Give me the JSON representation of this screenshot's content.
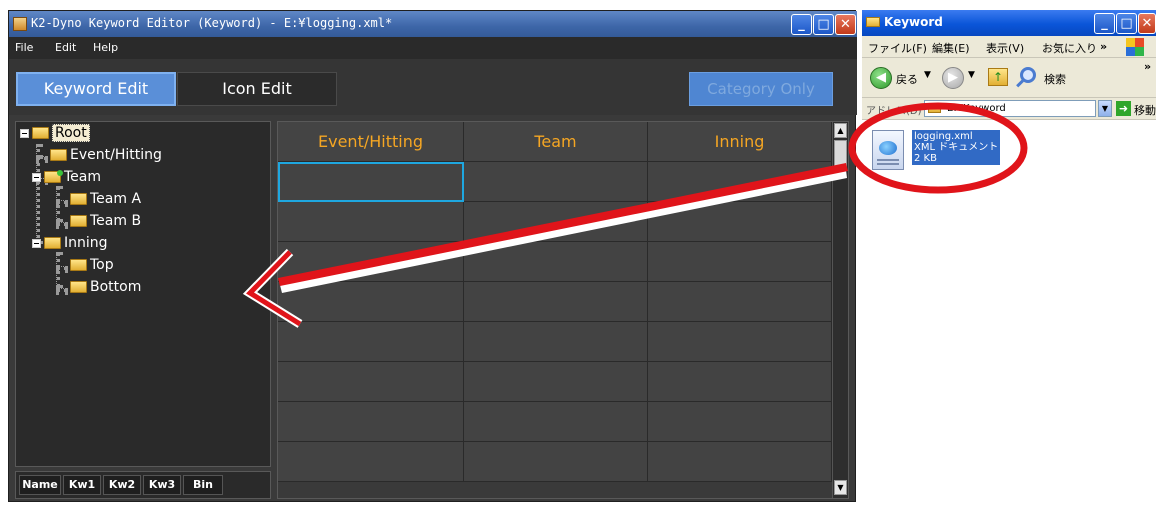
{
  "app": {
    "title": "K2-Dyno Keyword Editor (Keyword) - E:¥logging.xml*",
    "menu": [
      "File",
      "Edit",
      "Help"
    ],
    "tabs": {
      "keyword_edit": "Keyword Edit",
      "icon_edit": "Icon Edit"
    },
    "category_only": "Category Only",
    "tree": {
      "root": "Root",
      "event_hitting": "Event/Hitting",
      "team": "Team",
      "team_a": "Team A",
      "team_b": "Team B",
      "inning": "Inning",
      "top": "Top",
      "bottom": "Bottom"
    },
    "footer_buttons": [
      "Name",
      "Kw1",
      "Kw2",
      "Kw3",
      "Bin"
    ],
    "grid": {
      "columns": [
        "Event/Hitting",
        "Team",
        "Inning"
      ]
    },
    "colors": {
      "accent": "#5a8fd8",
      "header_text": "#f5a623",
      "background": "#3a3a3a"
    }
  },
  "explorer": {
    "title": "Keyword",
    "menu": [
      "ファイル(F)",
      "編集(E)",
      "表示(V)",
      "お気に入り",
      "»"
    ],
    "toolbar": {
      "back": "戻る",
      "search": "検索"
    },
    "address": {
      "label": "アドレス(D)",
      "value": "E:¥Keyword",
      "go": "移動"
    },
    "file": {
      "name": "logging.xml",
      "type": "XML ドキュメント",
      "size": "2 KB"
    }
  },
  "annotation": {
    "color": "#e0141a"
  }
}
